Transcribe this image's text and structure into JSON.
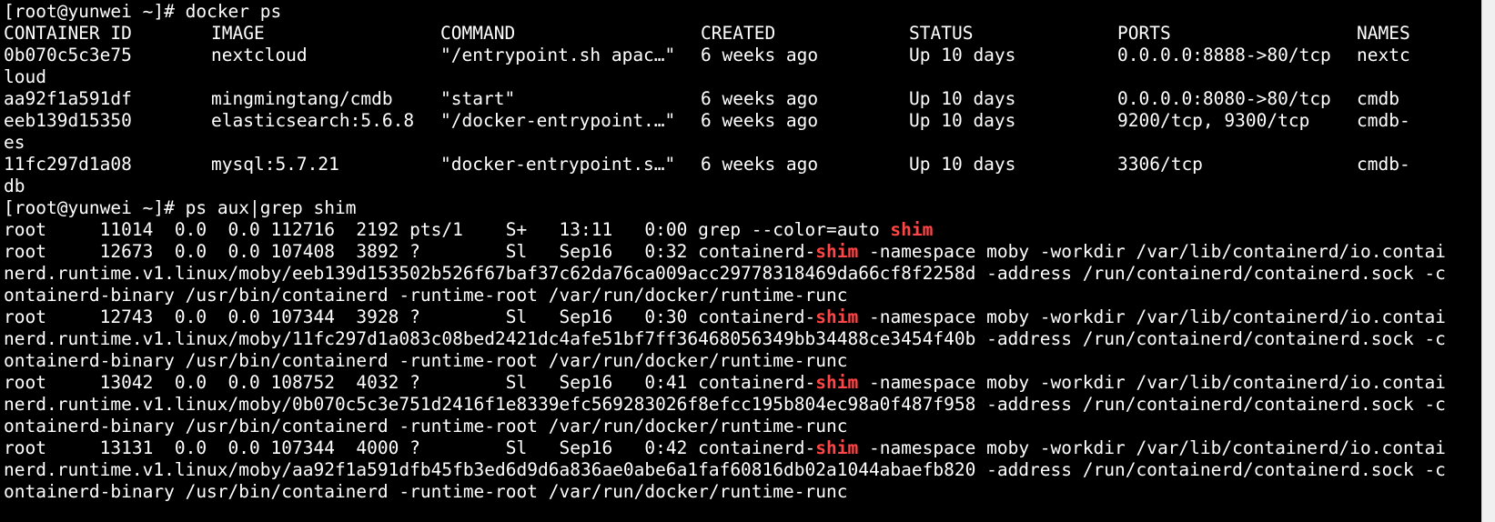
{
  "terminal": {
    "highlight_color": "#ff4545",
    "prompt": "[root@yunwei ~]# ",
    "docker_cmd": "docker ps",
    "ps_cmd": "ps aux|grep shim",
    "docker": {
      "header": [
        "CONTAINER ID",
        "IMAGE",
        "COMMAND",
        "CREATED",
        "STATUS",
        "PORTS",
        "NAMES"
      ],
      "rows": [
        {
          "id": "0b070c5c3e75",
          "image": "nextcloud",
          "command": "\"/entrypoint.sh apac…\"",
          "created": "6 weeks ago",
          "status": "Up 10 days",
          "ports": "0.0.0.0:8888->80/tcp",
          "name": "nextc",
          "name_cont": "loud"
        },
        {
          "id": "aa92f1a591df",
          "image": "mingmingtang/cmdb",
          "command": "\"start\"",
          "created": "6 weeks ago",
          "status": "Up 10 days",
          "ports": "0.0.0.0:8080->80/tcp",
          "name": "cmdb",
          "name_cont": ""
        },
        {
          "id": "eeb139d15350",
          "image": "elasticsearch:5.6.8",
          "command": "\"/docker-entrypoint.…\"",
          "created": "6 weeks ago",
          "status": "Up 10 days",
          "ports": "9200/tcp, 9300/tcp",
          "name": "cmdb-",
          "name_cont": "es"
        },
        {
          "id": "11fc297d1a08",
          "image": "mysql:5.7.21",
          "command": "\"docker-entrypoint.s…\"",
          "created": "6 weeks ago",
          "status": "Up 10 days",
          "ports": "3306/tcp",
          "name": "cmdb-",
          "name_cont": "db"
        }
      ]
    },
    "grep_line": {
      "prefix": "root     11014  0.0  0.0 112716  2192 pts/1    S+   13:11   0:00 grep --color=auto ",
      "match": "shim"
    },
    "shim_processes": [
      {
        "prefix": "root     12673  0.0  0.0 107408  3892 ?        Sl   Sep16   0:32 containerd-",
        "match": "shim",
        "suffix": " -namespace moby -workdir /var/lib/containerd/io.contai",
        "line2": "nerd.runtime.v1.linux/moby/eeb139d153502b526f67baf37c62da76ca009acc29778318469da66cf8f2258d -address /run/containerd/containerd.sock -c",
        "line3": "ontainerd-binary /usr/bin/containerd -runtime-root /var/run/docker/runtime-runc"
      },
      {
        "prefix": "root     12743  0.0  0.0 107344  3928 ?        Sl   Sep16   0:30 containerd-",
        "match": "shim",
        "suffix": " -namespace moby -workdir /var/lib/containerd/io.contai",
        "line2": "nerd.runtime.v1.linux/moby/11fc297d1a083c08bed2421dc4afe51bf7ff36468056349bb34488ce3454f40b -address /run/containerd/containerd.sock -c",
        "line3": "ontainerd-binary /usr/bin/containerd -runtime-root /var/run/docker/runtime-runc"
      },
      {
        "prefix": "root     13042  0.0  0.0 108752  4032 ?        Sl   Sep16   0:41 containerd-",
        "match": "shim",
        "suffix": " -namespace moby -workdir /var/lib/containerd/io.contai",
        "line2": "nerd.runtime.v1.linux/moby/0b070c5c3e751d2416f1e8339efc569283026f8efcc195b804ec98a0f487f958 -address /run/containerd/containerd.sock -c",
        "line3": "ontainerd-binary /usr/bin/containerd -runtime-root /var/run/docker/runtime-runc"
      },
      {
        "prefix": "root     13131  0.0  0.0 107344  4000 ?        Sl   Sep16   0:42 containerd-",
        "match": "shim",
        "suffix": " -namespace moby -workdir /var/lib/containerd/io.contai",
        "line2": "nerd.runtime.v1.linux/moby/aa92f1a591dfb45fb3ed6d9d6a836ae0abe6a1faf60816db02a1044abaefb820 -address /run/containerd/containerd.sock -c",
        "line3": "ontainerd-binary /usr/bin/containerd -runtime-root /var/run/docker/runtime-runc"
      }
    ]
  }
}
